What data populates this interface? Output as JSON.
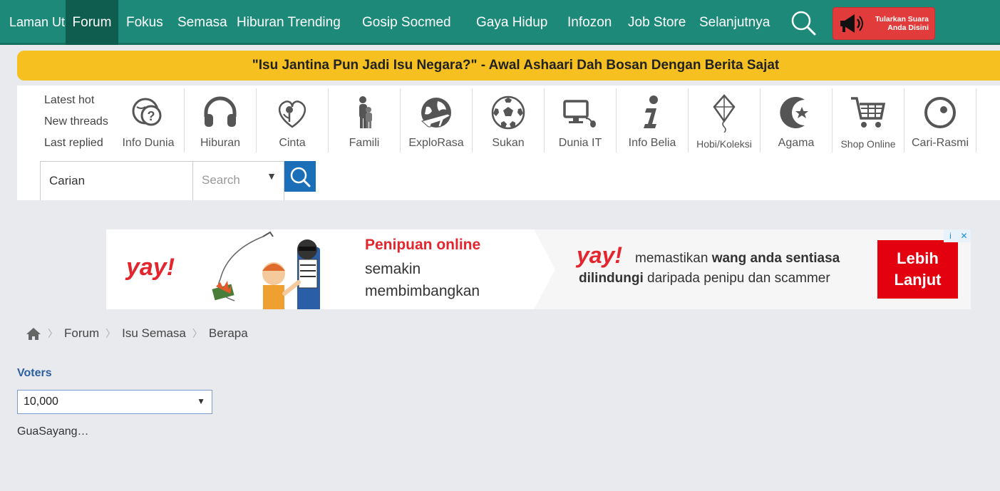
{
  "nav": {
    "home": "Laman Utama",
    "items": [
      "Forum",
      "Fokus",
      "Semasa",
      "Hiburan Trending",
      "Gosip Socmed",
      "Gaya Hidup",
      "Infozon",
      "Job Store",
      "Selanjutnya"
    ],
    "promo_line1": "Tularkan Suara",
    "promo_line2": "Anda Disini",
    "search_icon": "search-icon",
    "accent_color": "#1d8a79"
  },
  "headline": "\"Isu Jantina Pun Jadi Isu Negara?\" - Awal Ashaari Dah Bosan Dengan Berita Sajat",
  "quick_links": [
    "Latest hot",
    "New threads",
    "Last replied"
  ],
  "categories": [
    {
      "label": "Info Dunia",
      "icon": "globe-question-icon"
    },
    {
      "label": "Hiburan",
      "icon": "headphones-icon"
    },
    {
      "label": "Cinta",
      "icon": "heart-flower-icon"
    },
    {
      "label": "Famili",
      "icon": "family-icon"
    },
    {
      "label": "ExploRasa",
      "icon": "globe-plane-icon"
    },
    {
      "label": "Sukan",
      "icon": "soccer-ball-icon"
    },
    {
      "label": "Dunia IT",
      "icon": "computer-icon"
    },
    {
      "label": "Info Belia",
      "icon": "info-icon"
    },
    {
      "label": "Hobi/Koleksi",
      "icon": "kite-icon"
    },
    {
      "label": "Agama",
      "icon": "crescent-star-icon"
    },
    {
      "label": "Shop Online",
      "icon": "cart-icon"
    },
    {
      "label": "Cari-Rasmi",
      "icon": "cari-logo-icon"
    }
  ],
  "search": {
    "value": "Carian",
    "scope_placeholder": "Search"
  },
  "ad": {
    "brand": "yay!",
    "headline": "Penipuan online",
    "line2": "semakin",
    "line3": "membimbangkan",
    "tag_part1": "memastikan ",
    "tag_bold1": "wang anda sentiasa",
    "tag_bold2": "dilindungi",
    "tag_part2": " daripada penipu dan scammer",
    "cta_line1": "Lebih",
    "cta_line2": "Lanjut",
    "info": "i",
    "close": "✕",
    "brand_color": "#e3262e"
  },
  "breadcrumb": [
    "Forum",
    "Isu Semasa",
    "Berapa"
  ],
  "poll": {
    "label": "Voters",
    "selected": "10,000",
    "option": "GuaSayang…"
  }
}
